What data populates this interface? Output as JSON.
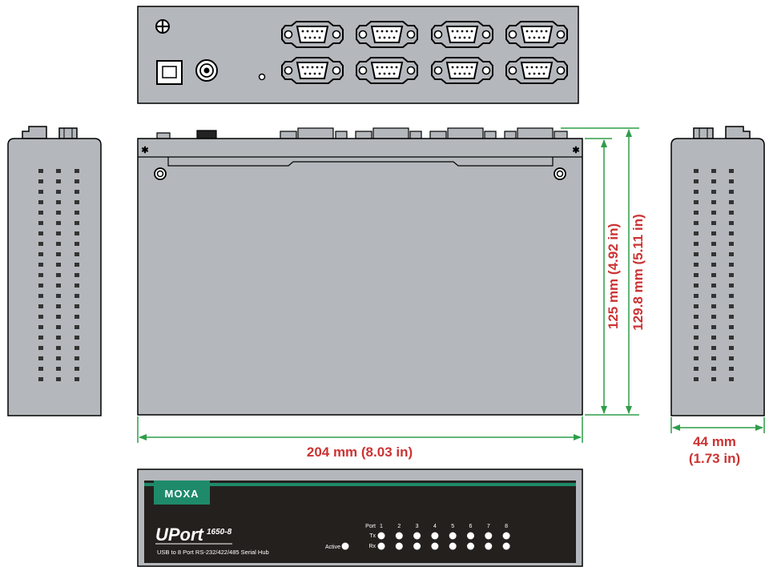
{
  "dimensions": {
    "width_label": "204 mm (8.03 in)",
    "depth_label": "125 mm (4.92 in)",
    "depth_total_label": "129.8 mm (5.11 in)",
    "height_label_line1": "44 mm",
    "height_label_line2": "(1.73 in)"
  },
  "front_panel": {
    "brand": "MOXA",
    "product_name": "UPort",
    "model": "1650-8",
    "subtitle": "USB to 8 Port RS-232/422/485 Serial Hub",
    "active_label": "Active",
    "port_label": "Port",
    "tx_label": "Tx",
    "rx_label": "Rx",
    "ports": [
      "1",
      "2",
      "3",
      "4",
      "5",
      "6",
      "7",
      "8"
    ]
  },
  "colors": {
    "dimension_text": "#cc3333",
    "dimension_line": "#2e9e48",
    "case_gray": "#b4b8bc",
    "panel_dark": "#24201e",
    "brand_green": "#1e8a6a"
  }
}
